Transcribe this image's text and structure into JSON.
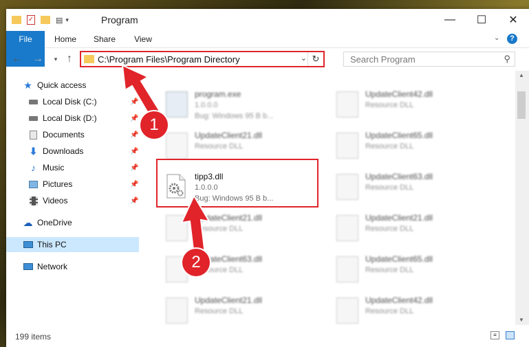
{
  "window": {
    "title": "Program"
  },
  "ribbon": {
    "tabs": [
      "File",
      "Home",
      "Share",
      "View"
    ]
  },
  "address": {
    "path": "C:\\Program Files\\Program Directory"
  },
  "search": {
    "placeholder": "Search Program"
  },
  "nav": {
    "quick_access": "Quick access",
    "items": [
      "Local Disk (C:)",
      "Local Disk (D:)",
      "Documents",
      "Downloads",
      "Music",
      "Pictures",
      "Videos"
    ],
    "onedrive": "OneDrive",
    "thispc": "This PC",
    "network": "Network"
  },
  "files": {
    "program": {
      "name": "program.exe",
      "l1": "1.0.0.0",
      "l2": "Bug: Windows 95 B b..."
    },
    "highlight": {
      "name": "tipp3.dll",
      "l1": "1.0.0.0",
      "l2": "Bug: Windows 95 B b..."
    },
    "left_col": [
      {
        "name": "UpdateClient21.dll",
        "l1": "Resource DLL"
      },
      {
        "name": "UpdateClient21.dll",
        "l1": "Resource DLL"
      },
      {
        "name": "UpdateClient63.dll",
        "l1": "Resource DLL"
      },
      {
        "name": "UpdateClient21.dll",
        "l1": "Resource DLL"
      }
    ],
    "right_col": [
      {
        "name": "UpdateClient42.dll",
        "l1": "Resource DLL"
      },
      {
        "name": "UpdateClient65.dll",
        "l1": "Resource DLL"
      },
      {
        "name": "UpdateClient63.dll",
        "l1": "Resource DLL"
      },
      {
        "name": "UpdateClient21.dll",
        "l1": "Resource DLL"
      },
      {
        "name": "UpdateClient65.dll",
        "l1": "Resource DLL"
      },
      {
        "name": "UpdateClient42.dll",
        "l1": "Resource DLL"
      }
    ]
  },
  "status": {
    "count": "199 items"
  },
  "annotations": {
    "one": "1",
    "two": "2"
  },
  "colors": {
    "accent": "#1979ca",
    "highlight": "#e0242a"
  }
}
